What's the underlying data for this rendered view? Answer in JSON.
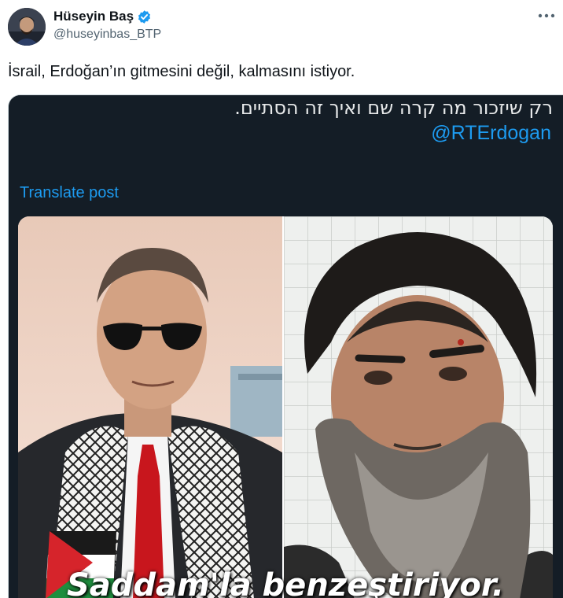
{
  "author": {
    "display_name": "Hüseyin Baş",
    "handle": "@huseyinbas_BTP",
    "verified_icon": "verified-badge-icon",
    "verified_color": "#1d9bf0"
  },
  "tweet": {
    "text": "İsrail, Erdoğan’ın gitmesini değil, kalmasını istiyor.",
    "more_icon": "more-icon"
  },
  "embedded_post": {
    "hebrew_text": "רק שיזכור מה קרה שם ואיך זה הסתיים.",
    "mention": "@RTErdogan",
    "translate_label": "Translate post"
  },
  "image": {
    "caption": "Saddam'la benzeştiriyor."
  },
  "colors": {
    "text_primary": "#0f1419",
    "text_secondary": "#536471",
    "accent": "#1d9bf0",
    "media_background": "#141d26"
  }
}
